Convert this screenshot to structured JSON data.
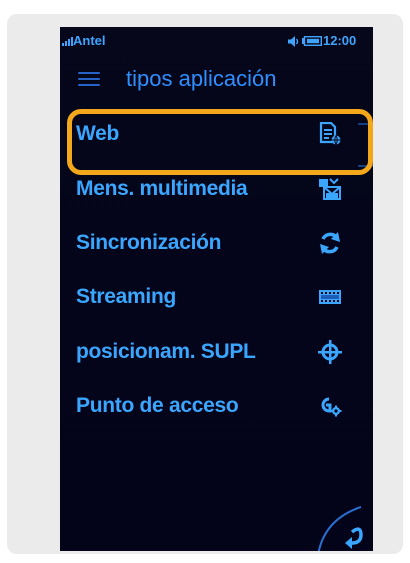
{
  "status_bar": {
    "carrier": "Antel",
    "time": "12:00"
  },
  "header": {
    "title": "tipos aplicación"
  },
  "items": [
    {
      "label": "Web",
      "icon": "web-page-icon"
    },
    {
      "label": "Mens. multimedia",
      "icon": "multimedia-message-icon"
    },
    {
      "label": "Sincronización",
      "icon": "sync-icon"
    },
    {
      "label": "Streaming",
      "icon": "film-strip-icon"
    },
    {
      "label": "posicionam. SUPL",
      "icon": "crosshair-icon"
    },
    {
      "label": "Punto de acceso",
      "icon": "access-point-icon"
    }
  ],
  "selected_index": 0,
  "colors": {
    "accent_text": "#3aa6ff",
    "highlight": "#f3a81b",
    "screen_bg": "#04051a"
  }
}
